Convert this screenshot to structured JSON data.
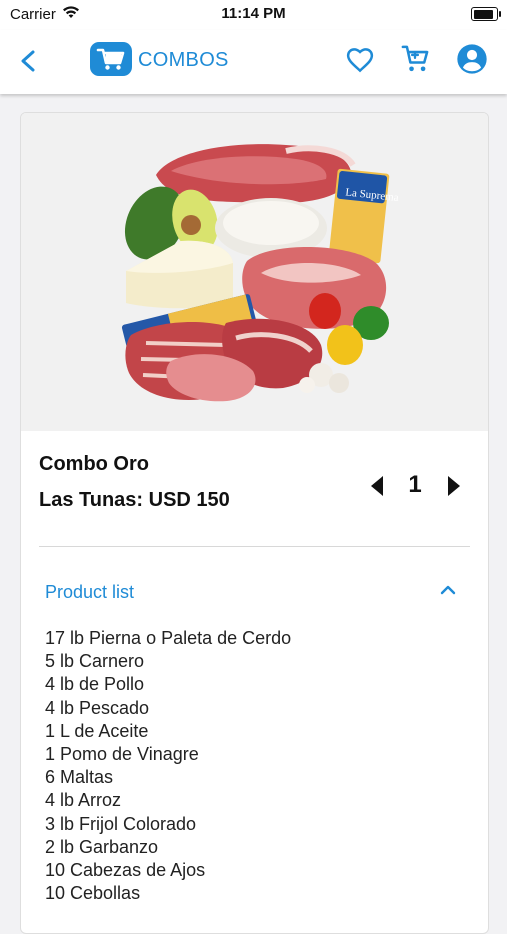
{
  "status_bar": {
    "carrier": "Carrier",
    "time": "11:14 PM",
    "battery_level": 1.0
  },
  "header": {
    "title": "COMBOS",
    "icons": [
      "back-arrow-icon",
      "cart-logo-icon",
      "heart-icon",
      "cart-icon",
      "account-icon"
    ]
  },
  "colors": {
    "accent": "#1f8bd6",
    "text": "#111111"
  },
  "product": {
    "name": "Combo Oro",
    "price_label": "Las Tunas: USD 150",
    "quantity": "1",
    "list_title": "Product list",
    "items": [
      "17 lb Pierna o Paleta de Cerdo",
      "5 lb Carnero",
      "4 lb de Pollo",
      "4 lb Pescado",
      "1 L de Aceite",
      "1 Pomo de Vinagre",
      "6 Maltas",
      "4 lb Arroz",
      "3 lb Frijol Colorado",
      "2 lb Garbanzo",
      "10 Cabezas de Ajos",
      "10 Cebollas"
    ],
    "package_brand": "La Suprema"
  }
}
